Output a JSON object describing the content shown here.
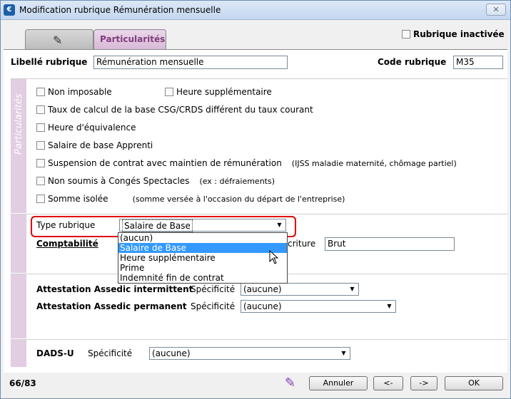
{
  "window": {
    "title": "Modification rubrique Rémunération mensuelle",
    "close_glyph": "✕"
  },
  "tabs": [
    {
      "label": "",
      "icon": "feather-icon"
    },
    {
      "label": "Particularités"
    }
  ],
  "header": {
    "inactive_label": "Rubrique inactivée",
    "libelle_label": "Libellé rubrique",
    "libelle_value": "Rémunération mensuelle",
    "code_label": "Code rubrique",
    "code_value": "M35"
  },
  "particularites": {
    "side_label": "Particularités",
    "non_imposable": "Non imposable",
    "heure_supp": "Heure supplémentaire",
    "taux_csg": "Taux de calcul de la base CSG/CRDS différent du taux courant",
    "heure_equiv": "Heure d'équivalence",
    "salaire_apprenti": "Salaire de base Apprenti",
    "suspension": "Suspension de contrat avec maintien de rémunération",
    "suspension_note": "(IJSS maladie maternité, chômage partiel)",
    "non_soumis": "Non soumis à Congés Spectacles",
    "non_soumis_note": "(ex : défraiements)",
    "somme_isolee": "Somme isolée",
    "somme_note": "(somme versée à l'occasion du départ de l'entreprise)"
  },
  "type_section": {
    "type_label": "Type rubrique",
    "type_value": "Salaire de Base",
    "options": [
      "(aucun)",
      "Salaire de Base",
      "Heure supplémentaire",
      "Prime",
      "Indemnité fin de contrat"
    ],
    "selected_index": 1,
    "comptabilite_label": "Comptabilité",
    "ecriture_label": "criture",
    "ecriture_value": "Brut"
  },
  "attestation": {
    "intermittent_label": "Attestation Assedic intermittent",
    "permanent_label": "Attestation Assedic permanent",
    "specificite_label": "Spécificité",
    "intermittent_value": "(aucune)",
    "permanent_value": "(aucune)"
  },
  "dads": {
    "label": "DADS-U",
    "specificite_label": "Spécificité",
    "value": "(aucune)"
  },
  "footer": {
    "record_count": "66/83",
    "annuler": "Annuler",
    "prev": "<-",
    "next": "->",
    "ok": "OK"
  },
  "colors": {
    "accent_purple": "#7d3f7b",
    "section_side": "#e2cde2",
    "selection": "#3399ff",
    "highlight": "#e00000"
  }
}
